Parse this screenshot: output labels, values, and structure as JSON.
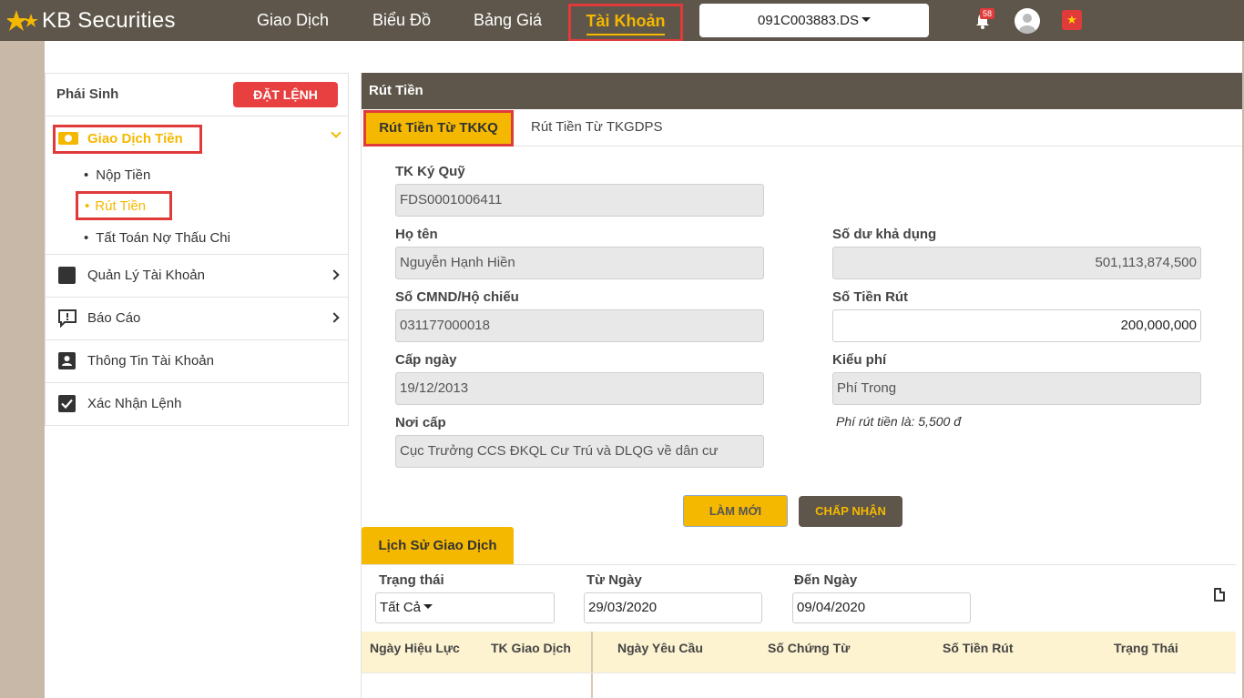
{
  "header": {
    "brand": "KB Securities",
    "nav": [
      "Giao Dịch",
      "Biểu Đồ",
      "Bảng Giá"
    ],
    "nav_active": "Tài Khoản",
    "account": "091C003883.DS",
    "notification_count": "58"
  },
  "sidebar": {
    "title": "Phái Sinh",
    "order_button": "ĐẶT LỆNH",
    "active_category": "Giao Dịch Tiền",
    "sub_items": [
      "Nộp Tiền",
      "Rút Tiền",
      "Tất Toán Nợ Thấu Chi"
    ],
    "menu": [
      "Quản Lý Tài Khoản",
      "Báo Cáo",
      "Thông Tin Tài Khoản",
      "Xác Nhận Lệnh"
    ]
  },
  "panel": {
    "title": "Rút Tiền",
    "tabs": [
      "Rút Tiền Từ TKKQ",
      "Rút Tiền Từ TKGDPS"
    ],
    "form": {
      "margin_account_label": "TK Ký Quỹ",
      "margin_account_value": "FDS0001006411",
      "name_label": "Họ tên",
      "name_value": "Nguyễn Hạnh Hiền",
      "id_label": "Số CMND/Hộ chiếu",
      "id_value": "031177000018",
      "issue_date_label": "Cấp ngày",
      "issue_date_value": "19/12/2013",
      "issue_place_label": "Nơi cấp",
      "issue_place_value": "Cục Trưởng CCS ĐKQL Cư Trú và DLQG về dân cư",
      "balance_label": "Số dư khả dụng",
      "balance_value": "501,113,874,500",
      "amount_label": "Số Tiền Rút",
      "amount_value": "200,000,000",
      "fee_type_label": "Kiểu phí",
      "fee_type_value": "Phí Trong",
      "fee_note": "Phí rút tiền là: 5,500 đ"
    },
    "buttons": {
      "refresh": "LÀM MỚI",
      "accept": "CHẤP NHẬN"
    },
    "history": {
      "tab": "Lịch Sử Giao Dịch",
      "status_label": "Trạng thái",
      "status_value": "Tất Cả",
      "from_label": "Từ Ngày",
      "from_value": "29/03/2020",
      "to_label": "Đến Ngày",
      "to_value": "09/04/2020",
      "columns": [
        "Ngày Hiệu Lực",
        "TK Giao Dịch",
        "Ngày Yêu Cầu",
        "Số Chứng Từ",
        "Số Tiền Rút",
        "Trạng Thái"
      ]
    }
  },
  "colors": {
    "header_bg": "#5e564a",
    "accent": "#f5b800",
    "highlight_border": "#e03a3a"
  }
}
